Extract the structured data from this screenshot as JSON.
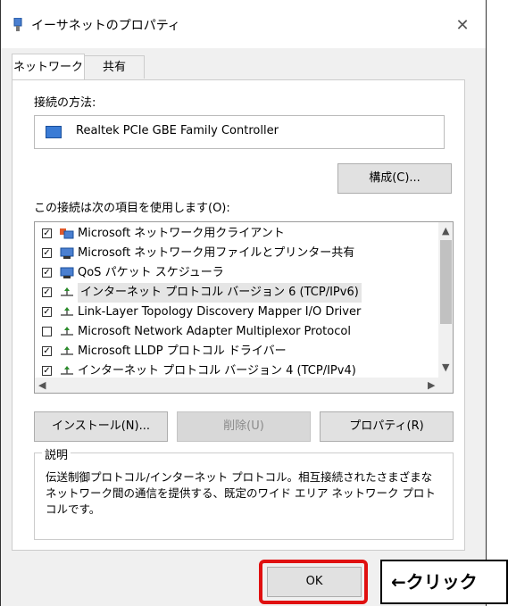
{
  "window": {
    "title": "イーサネットのプロパティ",
    "close_glyph": "✕"
  },
  "tabs": [
    {
      "label": "ネットワーク"
    },
    {
      "label": "共有"
    }
  ],
  "connect_using": {
    "label": "接続の方法:",
    "adapter": "Realtek PCIe GBE Family Controller",
    "configure_button": "構成(C)..."
  },
  "items": {
    "label": "この接続は次の項目を使用します(O):",
    "list": [
      {
        "checked": true,
        "icon": "client-icon",
        "label": "Microsoft ネットワーク用クライアント"
      },
      {
        "checked": true,
        "icon": "service-icon",
        "label": "Microsoft ネットワーク用ファイルとプリンター共有"
      },
      {
        "checked": true,
        "icon": "service-icon",
        "label": "QoS パケット スケジューラ"
      },
      {
        "checked": true,
        "icon": "protocol-icon",
        "label": "インターネット プロトコル バージョン 6 (TCP/IPv6)",
        "selected": true
      },
      {
        "checked": true,
        "icon": "protocol-icon",
        "label": "Link-Layer Topology Discovery Mapper I/O Driver"
      },
      {
        "checked": false,
        "icon": "protocol-icon",
        "label": "Microsoft Network Adapter Multiplexor Protocol"
      },
      {
        "checked": true,
        "icon": "protocol-icon",
        "label": "Microsoft LLDP プロトコル ドライバー"
      },
      {
        "checked": true,
        "icon": "protocol-icon",
        "label": "インターネット プロトコル バージョン 4 (TCP/IPv4)"
      }
    ]
  },
  "buttons": {
    "install": "インストール(N)...",
    "uninstall": "削除(U)",
    "properties": "プロパティ(R)"
  },
  "description": {
    "legend": "説明",
    "text": "伝送制御プロトコル/インターネット プロトコル。相互接続されたさまざまなネットワーク間の通信を提供する、既定のワイド エリア ネットワーク プロトコルです。"
  },
  "footer": {
    "ok": "OK"
  },
  "annotation": {
    "callout": "←クリック",
    "highlight_color": "#e01010"
  }
}
